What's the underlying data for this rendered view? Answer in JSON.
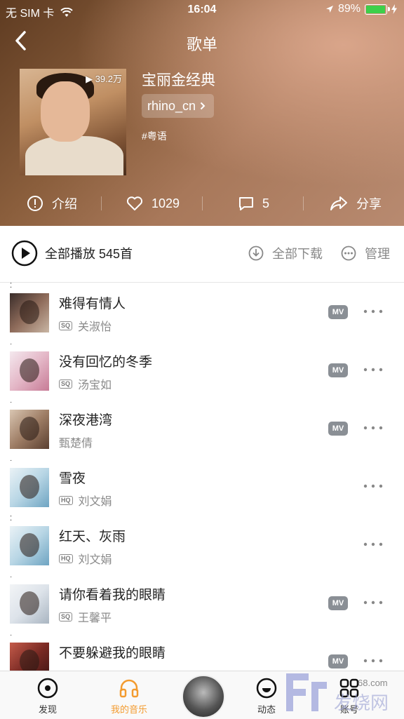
{
  "status": {
    "carrier": "无 SIM 卡",
    "time": "16:04",
    "battery": "89%",
    "battery_level": 0.89
  },
  "nav": {
    "title": "歌单"
  },
  "playlist": {
    "plays": "39.2万",
    "name": "宝丽金经典",
    "creator": "rhino_cn",
    "tag": "#粤语"
  },
  "actions": {
    "intro": "介绍",
    "likes": "1029",
    "comments": "5",
    "share": "分享"
  },
  "playbar": {
    "play_all": "全部播放 545首",
    "download_all": "全部下载",
    "manage": "管理"
  },
  "songs": [
    {
      "title": "难得有情人",
      "quality": "SQ",
      "artist": "关淑怡",
      "mv": "MV"
    },
    {
      "title": "没有回忆的冬季",
      "quality": "SQ",
      "artist": "汤宝如",
      "mv": "MV"
    },
    {
      "title": "深夜港湾",
      "quality": "",
      "artist": "甄楚倩",
      "mv": "MV"
    },
    {
      "title": "雪夜",
      "quality": "HQ",
      "artist": "刘文娟",
      "mv": ""
    },
    {
      "title": "红天、灰雨",
      "quality": "HQ",
      "artist": "刘文娟",
      "mv": ""
    },
    {
      "title": "请你看着我的眼睛",
      "quality": "SQ",
      "artist": "王馨平",
      "mv": "MV"
    },
    {
      "title": "不要躲避我的眼睛",
      "quality": "",
      "artist": "",
      "mv": "MV"
    }
  ],
  "tabs": {
    "discover": "发现",
    "my_music": "我的音乐",
    "feed": "动态",
    "account": "账号"
  },
  "watermark": {
    "text": "发烧网",
    "domain": "68.com"
  },
  "colors": {
    "accent": "#f39b2f",
    "mv_badge": "#8a8f95",
    "battery": "#3cd04a"
  }
}
